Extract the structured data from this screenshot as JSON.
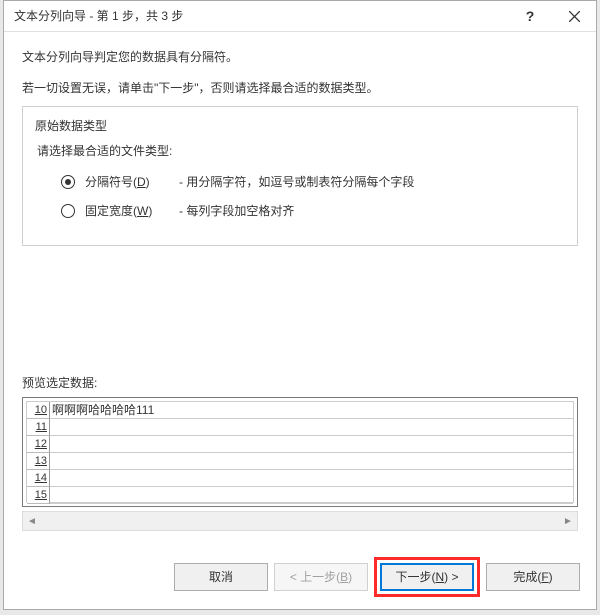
{
  "window": {
    "title": "文本分列向导 - 第 1 步，共 3 步"
  },
  "description": {
    "line1": "文本分列向导判定您的数据具有分隔符。",
    "line2": "若一切设置无误，请单击\"下一步\"，否则请选择最合适的数据类型。"
  },
  "fieldset": {
    "legend": "原始数据类型",
    "prompt": "请选择最合适的文件类型:"
  },
  "radios": {
    "delimited": {
      "label_pre": "分隔符号(",
      "hotkey": "D",
      "label_post": ")",
      "desc": "- 用分隔字符，如逗号或制表符分隔每个字段"
    },
    "fixed": {
      "label_pre": "固定宽度(",
      "hotkey": "W",
      "label_post": ")",
      "desc": "- 每列字段加空格对齐"
    }
  },
  "preview": {
    "caption": "预览选定数据:",
    "rows": [
      {
        "n": "10",
        "text": "啊啊啊哈哈哈哈111"
      },
      {
        "n": "11",
        "text": ""
      },
      {
        "n": "12",
        "text": ""
      },
      {
        "n": "13",
        "text": ""
      },
      {
        "n": "14",
        "text": ""
      },
      {
        "n": "15",
        "text": ""
      }
    ]
  },
  "buttons": {
    "cancel": "取消",
    "back": {
      "pre": "< 上一步(",
      "hk": "B",
      "post": ")"
    },
    "next": {
      "pre": "下一步(",
      "hk": "N",
      "post": ") >"
    },
    "finish": {
      "pre": "完成(",
      "hk": "F",
      "post": ")"
    }
  }
}
